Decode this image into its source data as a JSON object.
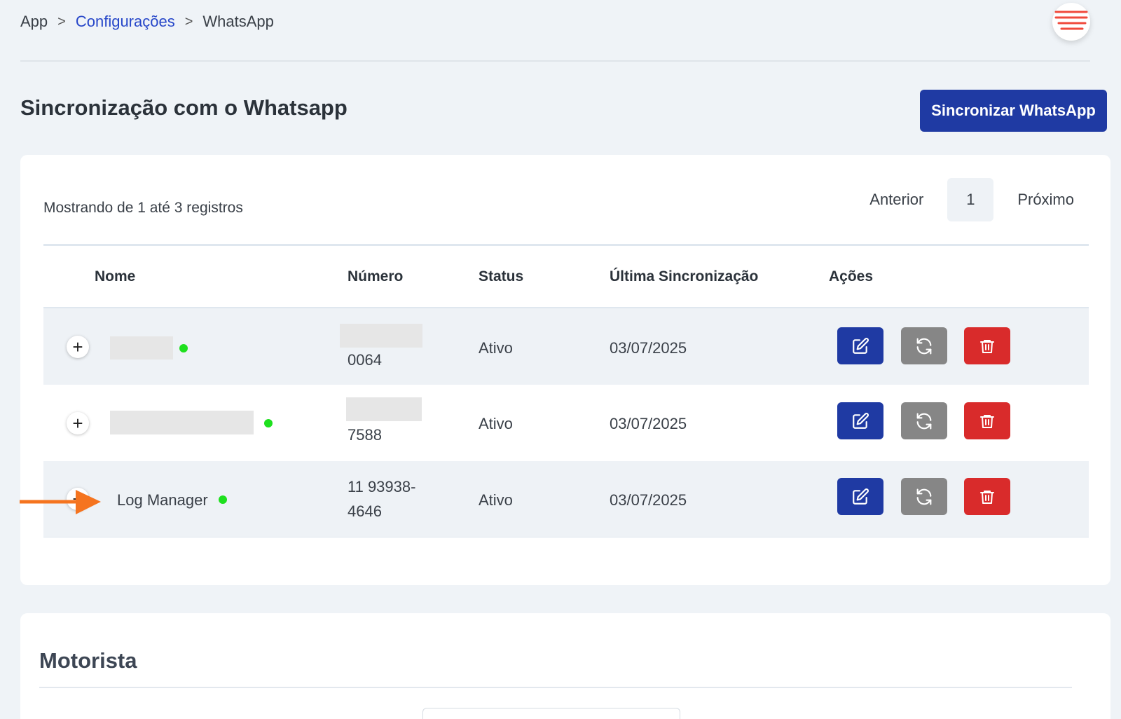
{
  "breadcrumb": {
    "items": [
      "App",
      "Configurações",
      "WhatsApp"
    ],
    "separator": ">"
  },
  "header": {
    "title": "Sincronização com o Whatsapp",
    "sync_button": "Sincronizar WhatsApp",
    "menu_icon": "hamburger-menu-icon"
  },
  "list": {
    "showing": "Mostrando de 1 até 3 registros",
    "pagination": {
      "previous": "Anterior",
      "current": "1",
      "next": "Próximo"
    },
    "columns": [
      "Nome",
      "Número",
      "Status",
      "Última Sincronização",
      "Ações"
    ],
    "rows": [
      {
        "name": "",
        "number_line1": "",
        "number_line2": "0064",
        "status": "Ativo",
        "last_sync": "03/07/2025"
      },
      {
        "name": "",
        "number_line1": "",
        "number_line2": "7588",
        "status": "Ativo",
        "last_sync": "03/07/2025"
      },
      {
        "name": "Log Manager",
        "number_line1": "11 93938-",
        "number_line2": "4646",
        "status": "Ativo",
        "last_sync": "03/07/2025"
      }
    ],
    "expand_symbol": "+"
  },
  "section2": {
    "title": "Motorista"
  },
  "colors": {
    "primary": "#1f3aa3",
    "danger": "#d92b2b",
    "neutral": "#868686",
    "online": "#1ee01e",
    "accent_arrow": "#f5741f",
    "link": "#2747c9"
  }
}
